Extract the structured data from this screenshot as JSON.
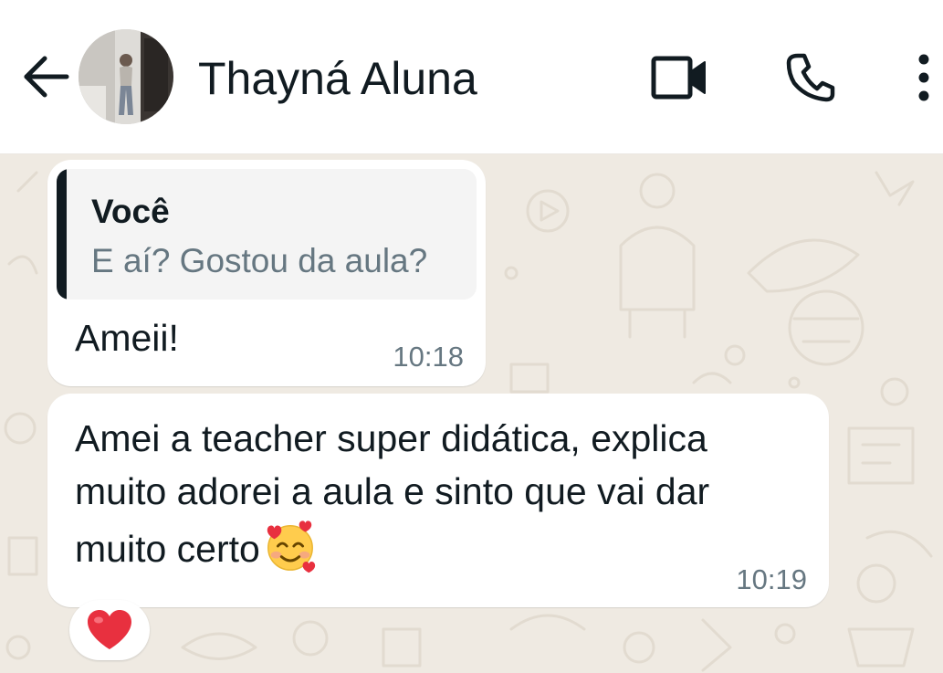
{
  "header": {
    "contact_name": "Thayná Aluna"
  },
  "messages": [
    {
      "quote": {
        "author": "Você",
        "text": "E aí? Gostou da aula?"
      },
      "text": "Ameii!",
      "time": "10:18"
    },
    {
      "text": "Amei a teacher super didática, explica muito adorei a aula e sinto que vai dar muito certo",
      "emoji": "smiling-face-with-hearts",
      "time": "10:19",
      "reaction": "red-heart"
    }
  ],
  "colors": {
    "chat_background": "#efeae2",
    "bubble": "#ffffff",
    "text": "#111b21",
    "meta": "#667781",
    "quote_bar": "#111b21"
  }
}
